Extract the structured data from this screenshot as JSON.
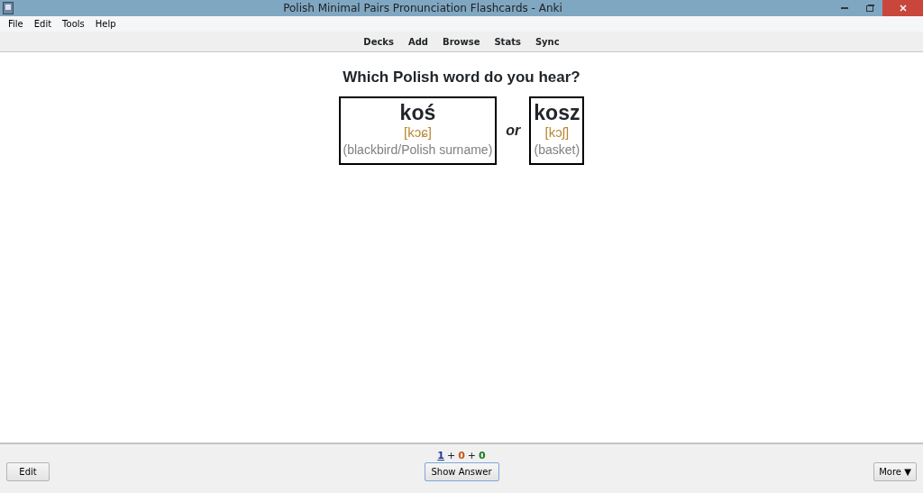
{
  "window": {
    "title": "Polish Minimal Pairs Pronunciation Flashcards - Anki"
  },
  "menu": [
    "File",
    "Edit",
    "Tools",
    "Help"
  ],
  "toolbar": [
    "Decks",
    "Add",
    "Browse",
    "Stats",
    "Sync"
  ],
  "card": {
    "question": "Which Polish word do you hear?",
    "separator": "or",
    "options": [
      {
        "word": "koś",
        "ipa": "[kɔɕ]",
        "meaning": "(blackbird/Polish surname)"
      },
      {
        "word": "kosz",
        "ipa": "[kɔʃ]",
        "meaning": "(basket)"
      }
    ]
  },
  "counts": [
    {
      "value": "1",
      "color": "#1f3b9b",
      "underlined": true
    },
    {
      "value": "0",
      "color": "#c35617",
      "underlined": false
    },
    {
      "value": "0",
      "color": "#1d7b1d",
      "underlined": false
    }
  ],
  "count_separator": "+",
  "buttons": {
    "edit": "Edit",
    "show_answer": "Show Answer",
    "more": "More ▼"
  }
}
